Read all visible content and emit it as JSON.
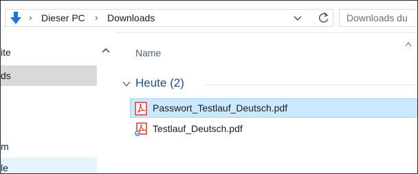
{
  "address_bar": {
    "icon": "down-arrow-icon",
    "separator": "›",
    "breadcrumbs": [
      {
        "label": "Dieser PC"
      },
      {
        "label": "Downloads"
      }
    ],
    "dropdown_icon": "chevron-down-icon",
    "refresh_icon": "refresh-icon"
  },
  "search": {
    "placeholder": "Downloads du"
  },
  "navigation": {
    "items": [
      {
        "label": "ite",
        "state": "normal"
      },
      {
        "label": "ds",
        "state": "selected"
      },
      {
        "label": "m",
        "state": "normal"
      },
      {
        "label": "le",
        "state": "hover"
      }
    ]
  },
  "content": {
    "column_header": "Name",
    "group": {
      "label": "Heute (2)"
    },
    "files": [
      {
        "name": "Passwort_Testlauf_Deutsch.pdf",
        "icon": "pdf-icon",
        "selected": true
      },
      {
        "name": "Testlauf_Deutsch.pdf",
        "icon": "pdf-shared-icon",
        "selected": false
      }
    ]
  },
  "colors": {
    "selection_bg": "#cce8ff",
    "selection_border": "#99d1ff",
    "group_header": "#1e4e8c",
    "nav_selected": "#d9d9d9",
    "nav_hover": "#e5f3ff",
    "accent_arrow": "#1e73d8",
    "pdf_red": "#d9281f"
  }
}
